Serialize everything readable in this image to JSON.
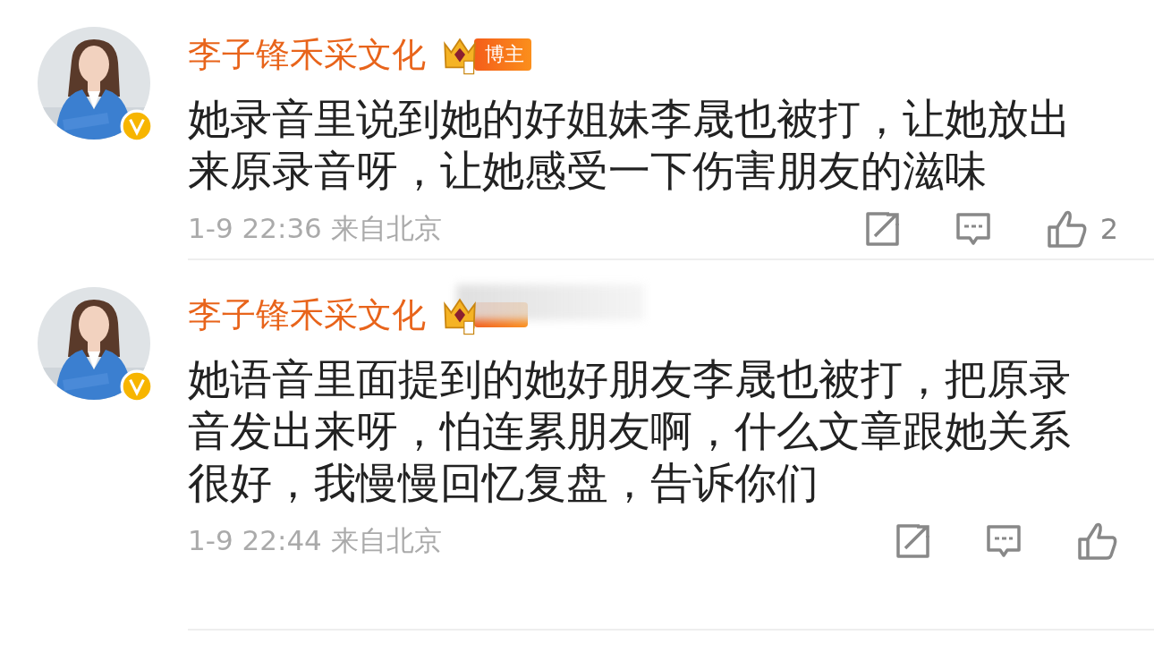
{
  "comments": [
    {
      "author": "李子锋禾采文化",
      "verified": true,
      "badge": {
        "label": "博主",
        "obscured": false
      },
      "text": "她录音里说到她的好姐妹李晟也被打，让她放出来原录音呀，让她感受一下伤害朋友的滋味",
      "time": "1-9 22:36",
      "location": "来自北京",
      "likes": "2"
    },
    {
      "author": "李子锋禾采文化",
      "verified": true,
      "badge": {
        "obscured": true
      },
      "text": "她语音里面提到的她好朋友李晟也被打，把原录音发出来呀，怕连累朋友啊，什么文章跟她关系很好，我慢慢回忆复盘，告诉你们",
      "time": "1-9 22:44",
      "location": "来自北京"
    }
  ]
}
